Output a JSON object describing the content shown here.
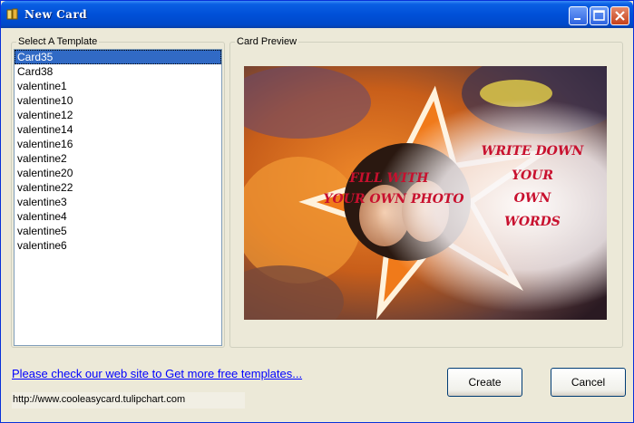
{
  "window": {
    "title": "New Card"
  },
  "template_group": {
    "legend": "Select A Template",
    "items": [
      "Card35",
      "Card38",
      "valentine1",
      "valentine10",
      "valentine12",
      "valentine14",
      "valentine16",
      "valentine2",
      "valentine20",
      "valentine22",
      "valentine3",
      "valentine4",
      "valentine5",
      "valentine6"
    ],
    "selected_index": 0
  },
  "preview_group": {
    "legend": "Card Preview",
    "photo_text": [
      "FILL WITH",
      "YOUR OWN PHOTO"
    ],
    "words_text": [
      "WRITE DOWN",
      "YOUR",
      "OWN",
      "WORDS"
    ]
  },
  "footer": {
    "link": "Please check our web site to Get more free templates...",
    "url": "http://www.cooleasycard.tulipchart.com",
    "create_label": "Create",
    "cancel_label": "Cancel"
  },
  "colors": {
    "title_bar": "#0050d8",
    "selection": "#316ac5",
    "link": "#0000ff",
    "card_text": "#c8102e"
  },
  "icons": {
    "title": "card-book-icon",
    "minimize": "minimize-icon",
    "maximize": "maximize-icon",
    "close": "close-icon"
  }
}
